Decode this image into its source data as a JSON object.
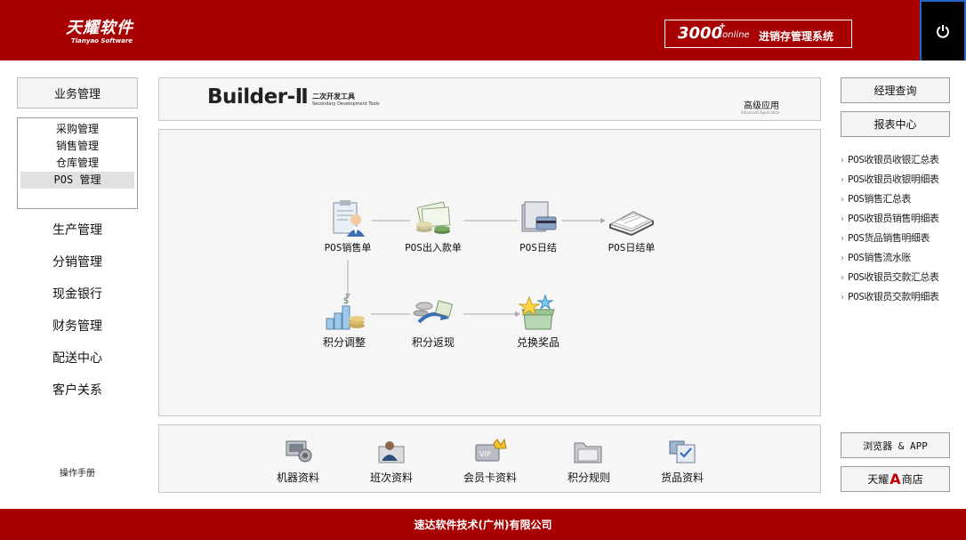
{
  "header": {
    "logo_cn": "天耀软件",
    "logo_en": "Tianyao Software",
    "product_num": "3000",
    "product_plus": "+",
    "product_online": ".online",
    "product_name": "进销存管理系统",
    "power_icon": "power-icon"
  },
  "left": {
    "business_btn": "业务管理",
    "submenu": [
      "采购管理",
      "销售管理",
      "仓库管理",
      "POS 管理"
    ],
    "active_submenu": "POS 管理",
    "nav": [
      "生产管理",
      "分销管理",
      "现金银行",
      "财务管理",
      "配送中心",
      "客户关系"
    ],
    "manual": "操作手册"
  },
  "banner": {
    "title": "Builder-Ⅱ",
    "subtitle_cn": "二次开发工具",
    "subtitle_en": "Secondary Development Tools",
    "advanced": "高级应用",
    "advanced_en": "Advanced Application"
  },
  "flow": {
    "nodes": [
      {
        "label": "POS销售单",
        "icon": "clipboard-person-icon"
      },
      {
        "label": "POS出入款单",
        "icon": "money-stack-icon"
      },
      {
        "label": "POS日结",
        "icon": "folder-card-icon"
      },
      {
        "label": "POS日结单",
        "icon": "open-book-icon"
      },
      {
        "label": "积分调整",
        "icon": "coin-stacks-icon"
      },
      {
        "label": "积分返现",
        "icon": "cash-return-icon"
      },
      {
        "label": "兑换奖品",
        "icon": "gift-box-icon"
      }
    ]
  },
  "basics": {
    "items": [
      {
        "label": "机器资料",
        "icon": "machine-icon"
      },
      {
        "label": "班次资料",
        "icon": "shift-person-icon"
      },
      {
        "label": "会员卡资料",
        "icon": "member-card-icon"
      },
      {
        "label": "积分规则",
        "icon": "rule-folder-icon"
      },
      {
        "label": "货品资料",
        "icon": "goods-checklist-icon"
      }
    ]
  },
  "right": {
    "manager_query": "经理查询",
    "report_center": "报表中心",
    "reports": [
      "POS收银员收银汇总表",
      "POS收银员收银明细表",
      "POS销售汇总表",
      "POS收银员销售明细表",
      "POS货品销售明细表",
      "POS销售流水账",
      "POS收银员交款汇总表",
      "POS收银员交款明细表"
    ],
    "browser_app": "浏览器 & APP",
    "store_pre": "天耀",
    "store_a": "A",
    "store_post": "商店"
  },
  "footer": {
    "company": "速达软件技术(广州)有限公司"
  },
  "colors": {
    "brand_red": "#a80000",
    "panel_bg": "#f6f6f6",
    "power_bg": "#000000"
  }
}
